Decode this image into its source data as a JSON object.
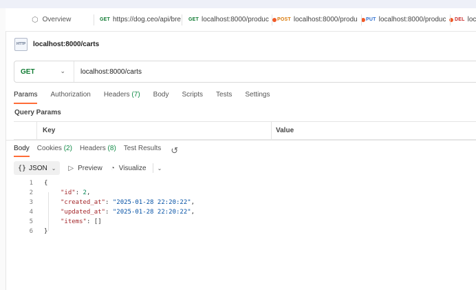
{
  "tabs": [
    {
      "label": "Overview"
    },
    {
      "method": "GET",
      "label": "https://dog.ceo/api/bre",
      "color": "#0e7a31",
      "dot": false
    },
    {
      "method": "GET",
      "label": "localhost:8000/produc",
      "color": "#0e7a31",
      "dot": true
    },
    {
      "method": "POST",
      "label": "localhost:8000/produ",
      "color": "#d97706",
      "dot": true
    },
    {
      "method": "PUT",
      "label": "localhost:8000/produc",
      "color": "#2e6fcf",
      "dot": true
    },
    {
      "method": "DEL",
      "label": "loca",
      "color": "#c92a2a",
      "dot": false
    }
  ],
  "request": {
    "icon_text": "HTTP",
    "name": "localhost:8000/carts",
    "method": "GET",
    "url": "localhost:8000/carts"
  },
  "request_tabs": [
    {
      "label": "Params",
      "count": ""
    },
    {
      "label": "Authorization",
      "count": ""
    },
    {
      "label": "Headers",
      "count": "(7)"
    },
    {
      "label": "Body",
      "count": ""
    },
    {
      "label": "Scripts",
      "count": ""
    },
    {
      "label": "Tests",
      "count": ""
    },
    {
      "label": "Settings",
      "count": ""
    }
  ],
  "query_params": {
    "title": "Query Params",
    "columns": [
      "Key",
      "Value"
    ]
  },
  "response_tabs": [
    {
      "label": "Body",
      "count": ""
    },
    {
      "label": "Cookies",
      "count": "(2)"
    },
    {
      "label": "Headers",
      "count": "(8)"
    },
    {
      "label": "Test Results",
      "count": ""
    }
  ],
  "response_toolbar": {
    "format": "JSON",
    "preview": "Preview",
    "visualize": "Visualize"
  },
  "response_body": {
    "line_numbers": [
      "1",
      "2",
      "3",
      "4",
      "5",
      "6"
    ],
    "open_brace": "{",
    "close_brace": "}",
    "fields": [
      {
        "key": "\"id\"",
        "value": "2",
        "type": "num",
        "comma": ","
      },
      {
        "key": "\"created_at\"",
        "value": "\"2025-01-28 22:20:22\"",
        "type": "str",
        "comma": ","
      },
      {
        "key": "\"updated_at\"",
        "value": "\"2025-01-28 22:20:22\"",
        "type": "str",
        "comma": ","
      },
      {
        "key": "\"items\"",
        "value": "[]",
        "type": "plain",
        "comma": ""
      }
    ]
  }
}
